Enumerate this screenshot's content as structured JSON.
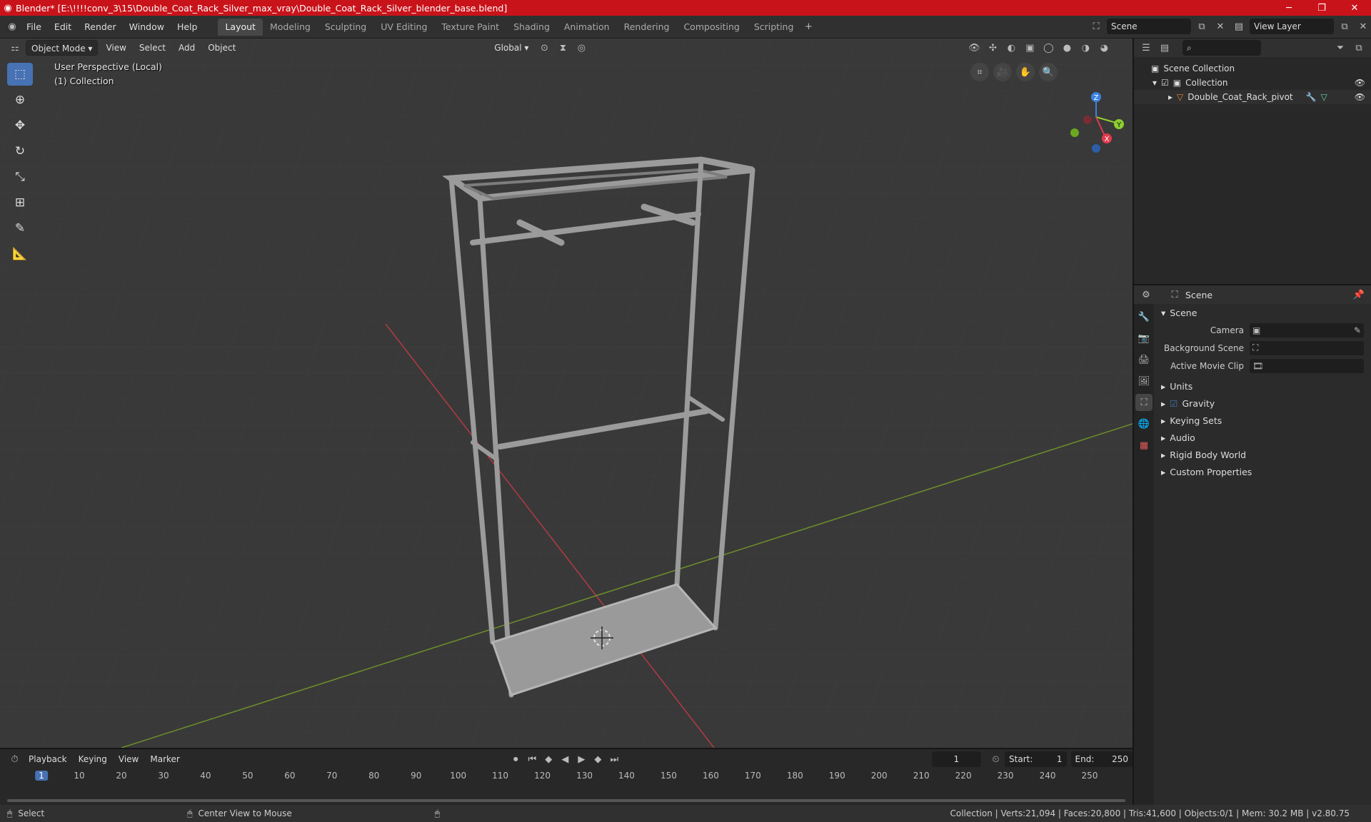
{
  "window": {
    "title": "Blender* [E:\\!!!!conv_3\\15\\Double_Coat_Rack_Silver_max_vray\\Double_Coat_Rack_Silver_blender_base.blend]"
  },
  "menu": [
    "File",
    "Edit",
    "Render",
    "Window",
    "Help"
  ],
  "workspaces": [
    "Layout",
    "Modeling",
    "Sculpting",
    "UV Editing",
    "Texture Paint",
    "Shading",
    "Animation",
    "Rendering",
    "Compositing",
    "Scripting"
  ],
  "topright": {
    "scene": "Scene",
    "view_layer": "View Layer"
  },
  "viewport": {
    "mode": "Object Mode",
    "menus": [
      "View",
      "Select",
      "Add",
      "Object"
    ],
    "orientation": "Global",
    "info_line1": "User Perspective (Local)",
    "info_line2": "(1) Collection",
    "axes": {
      "x": "X",
      "y": "Y",
      "z": "Z"
    }
  },
  "outliner": {
    "root": "Scene Collection",
    "collection": "Collection",
    "object": "Double_Coat_Rack_pivot"
  },
  "properties": {
    "header": "Scene",
    "section": "Scene",
    "rows": [
      "Camera",
      "Background Scene",
      "Active Movie Clip"
    ],
    "subsections": [
      "Units",
      "Gravity",
      "Keying Sets",
      "Audio",
      "Rigid Body World",
      "Custom Properties"
    ]
  },
  "timeline": {
    "menus": [
      "Playback",
      "Keying",
      "View",
      "Marker"
    ],
    "current_frame": "1",
    "start_label": "Start:",
    "start": "1",
    "end_label": "End:",
    "end": "250",
    "ticks": [
      "1",
      "10",
      "20",
      "30",
      "40",
      "50",
      "60",
      "70",
      "80",
      "90",
      "100",
      "110",
      "120",
      "130",
      "140",
      "150",
      "160",
      "170",
      "180",
      "190",
      "200",
      "210",
      "220",
      "230",
      "240",
      "250"
    ]
  },
  "statusbar": {
    "select": "Select",
    "center": "Center View to Mouse",
    "stats": "Collection | Verts:21,094 | Faces:20,800 | Tris:41,600 | Objects:0/1 | Mem: 30.2 MB | v2.80.75"
  },
  "colors": {
    "accent": "#4772b3",
    "titlebar": "#c9131a",
    "x_axis": "#e23a4e",
    "y_axis": "#8ccf2f",
    "z_axis": "#3a82e2"
  }
}
